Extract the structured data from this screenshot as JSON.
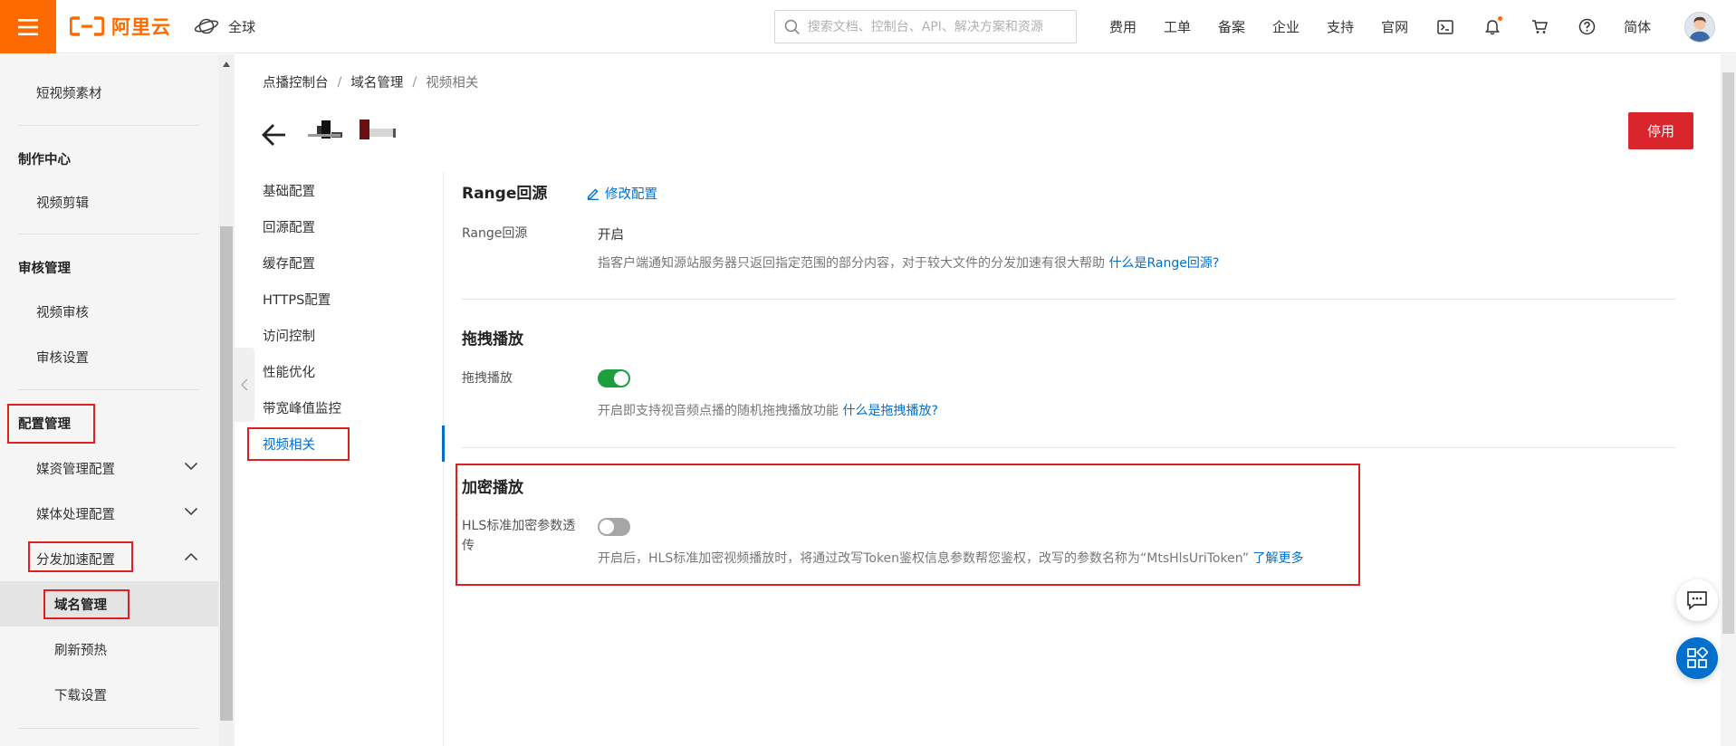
{
  "header": {
    "logo_text": "阿里云",
    "region_label": "全球",
    "search_placeholder": "搜索文档、控制台、API、解决方案和资源",
    "nav_links": [
      "费用",
      "工单",
      "备案",
      "企业",
      "支持",
      "官网"
    ],
    "lang_label": "简体",
    "icons": [
      "terminal-icon",
      "bell-icon",
      "cart-icon",
      "help-icon"
    ],
    "brand_color": "#ff6a00"
  },
  "sidebar": {
    "item_short_video": "短视频素材",
    "group_production": "制作中心",
    "item_video_edit": "视频剪辑",
    "group_review": "审核管理",
    "item_video_review": "视频审核",
    "item_review_settings": "审核设置",
    "group_config": "配置管理",
    "item_media_config": "媒资管理配置",
    "item_media_process": "媒体处理配置",
    "item_cdn_config": "分发加速配置",
    "item_domain": "域名管理",
    "item_refresh": "刷新预热",
    "item_download": "下载设置"
  },
  "breadcrumb": {
    "item_1": "点播控制台",
    "item_2": "域名管理",
    "item_3": "视频相关",
    "separator": "/"
  },
  "page": {
    "stop_button": "停用"
  },
  "subnav": {
    "items": [
      "基础配置",
      "回源配置",
      "缓存配置",
      "HTTPS配置",
      "访问控制",
      "性能优化",
      "带宽峰值监控",
      "视频相关"
    ],
    "active": "视频相关"
  },
  "range_section": {
    "title": "Range回源",
    "edit_link": "修改配置",
    "label": "Range回源",
    "value": "开启",
    "desc": "指客户端通知源站服务器只返回指定范围的部分内容，对于较大文件的分发加速有很大帮助",
    "desc_link": "什么是Range回源?"
  },
  "drag_section": {
    "title": "拖拽播放",
    "label": "拖拽播放",
    "toggle_state": "on",
    "desc": "开启即支持视音频点播的随机拖拽播放功能",
    "desc_link": "什么是拖拽播放?"
  },
  "encrypt_section": {
    "title": "加密播放",
    "label_line1": "HLS标准加密参数透",
    "label_line2": "传",
    "toggle_state": "off",
    "desc": "开启后，HLS标准加密视频播放时，将通过改写Token鉴权信息参数帮您鉴权，改写的参数名称为“MtsHlsUriToken”",
    "desc_link": "了解更多"
  },
  "colors": {
    "link": "#0070cc",
    "toggle_on": "#1e9f3e",
    "toggle_off": "#a6a6a6",
    "danger": "#d9262c",
    "annotation": "#e02020"
  }
}
